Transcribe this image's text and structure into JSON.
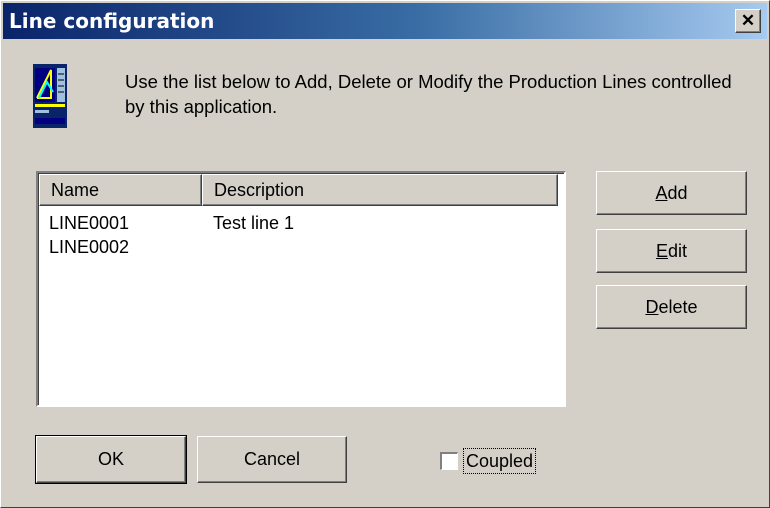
{
  "window": {
    "title": "Line configuration",
    "close_glyph": "✕"
  },
  "header": {
    "icon": "production-line-icon",
    "intro_text": "Use the list below to Add, Delete or Modify the Production Lines controlled by this application."
  },
  "list": {
    "columns": [
      "Name",
      "Description"
    ],
    "rows": [
      {
        "name": "LINE0001",
        "description": "Test line 1"
      },
      {
        "name": "LINE0002",
        "description": ""
      }
    ]
  },
  "buttons": {
    "add_mnemonic": "A",
    "add_rest": "dd",
    "edit_mnemonic": "E",
    "edit_rest": "dit",
    "delete_mnemonic": "D",
    "delete_rest": "elete",
    "ok": "OK",
    "cancel": "Cancel"
  },
  "coupled": {
    "label": "Coupled",
    "checked": false
  }
}
